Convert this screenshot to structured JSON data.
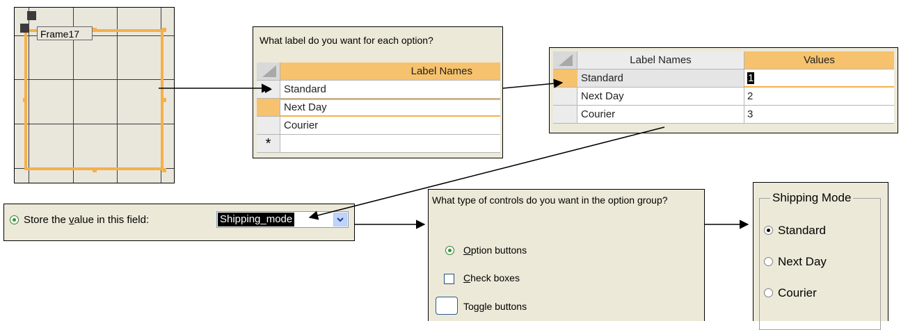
{
  "frame_panel": {
    "frame_label": "Frame17"
  },
  "label_panel": {
    "question": "What label do you want for each option?",
    "column_header": "Label Names",
    "rows": [
      "Standard",
      "Next Day",
      "Courier"
    ],
    "new_row_marker": "*"
  },
  "values_panel": {
    "headers": [
      "Label Names",
      "Values"
    ],
    "rows": [
      {
        "label": "Standard",
        "value": "1"
      },
      {
        "label": "Next Day",
        "value": "2"
      },
      {
        "label": "Courier",
        "value": "3"
      }
    ]
  },
  "store_panel": {
    "option_text_before": "Store the ",
    "option_text_accel": "v",
    "option_text_after": "alue in this field:",
    "combo_value": "Shipping_mode"
  },
  "controls_panel": {
    "question": "What type of controls do you want in the option group?",
    "options": [
      {
        "accel": "O",
        "rest": "ption buttons"
      },
      {
        "accel": "C",
        "rest": "heck boxes"
      },
      {
        "accel": "",
        "rest": "Toggle buttons"
      }
    ]
  },
  "shipping_panel": {
    "legend": "Shipping Mode",
    "options": [
      "Standard",
      "Next Day",
      "Courier"
    ]
  },
  "colors": {
    "accent_orange": "#f5b04a",
    "header_orange": "#f6c26e",
    "dialog_bg": "#ece9d8"
  }
}
